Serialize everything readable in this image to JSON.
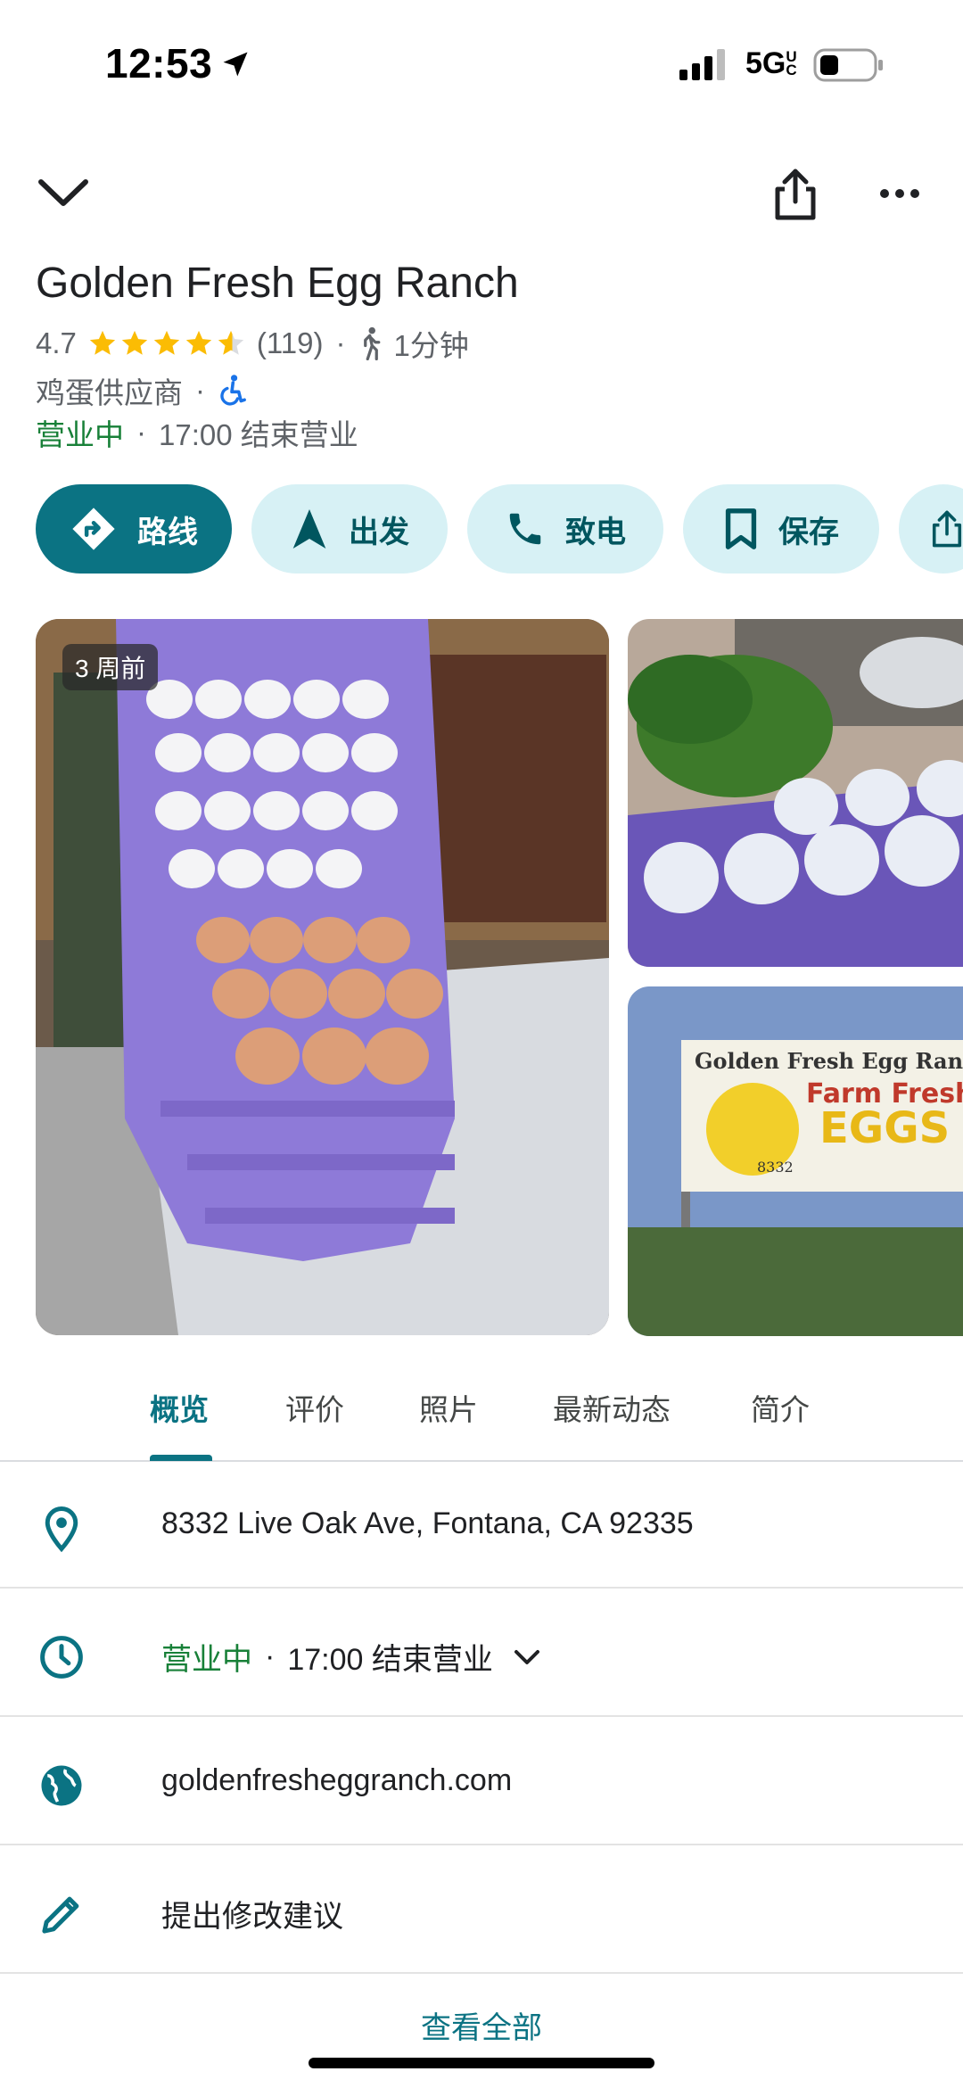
{
  "status_bar": {
    "time": "12:53",
    "network": "5G",
    "network_suffix": "UC"
  },
  "place": {
    "name": "Golden Fresh Egg Ranch",
    "rating": "4.7",
    "rating_stars": 4.7,
    "review_count": "(119)",
    "walk_time": "1分钟",
    "category": "鸡蛋供应商",
    "open_status": "营业中",
    "closing": "17:00 结束营业"
  },
  "actions": [
    {
      "label": "路线",
      "icon": "directions-icon"
    },
    {
      "label": "出发",
      "icon": "navigation-arrow-icon"
    },
    {
      "label": "致电",
      "icon": "phone-icon"
    },
    {
      "label": "保存",
      "icon": "bookmark-icon"
    },
    {
      "label": "",
      "icon": "share-icon"
    }
  ],
  "photos": {
    "main_badge": "3 周前"
  },
  "tabs": [
    "概览",
    "评价",
    "照片",
    "最新动态",
    "简介"
  ],
  "active_tab": "概览",
  "details": {
    "address": "8332 Live Oak Ave, Fontana, CA 92335",
    "hours_status": "营业中",
    "hours_closing": "17:00 结束营业",
    "website": "goldenfresheggranch.com",
    "suggest_edit": "提出修改建议"
  },
  "see_all": "查看全部",
  "colors": {
    "accent": "#0b7383",
    "open_green": "#188038",
    "star": "#fbbc04",
    "chip_bg": "#d7f1f5"
  }
}
